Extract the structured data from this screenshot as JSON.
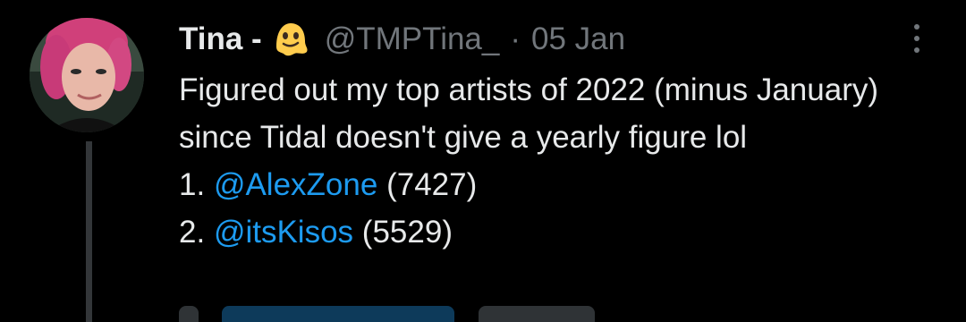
{
  "tweet": {
    "display_name": "Tina -",
    "name_emoji": "melting-face-emoji",
    "handle": "@TMPTina_",
    "separator": "·",
    "date": "05 Jan",
    "text": "Figured out my top artists of 2022 (minus January) since Tidal doesn't give a yearly figure lol",
    "list": [
      {
        "rank": "1.",
        "mention": "@AlexZone",
        "count": "(7427)"
      },
      {
        "rank": "2.",
        "mention": "@itsKisos",
        "count": "(5529)"
      }
    ]
  },
  "icons": {
    "more": "more-options-icon",
    "avatar": "profile-photo"
  },
  "colors": {
    "background": "#000000",
    "primary_text": "#e7e9ea",
    "secondary_text": "#71767b",
    "link": "#1d9bf0",
    "thread_line": "#333639",
    "emoji": "#ffcc4d"
  }
}
